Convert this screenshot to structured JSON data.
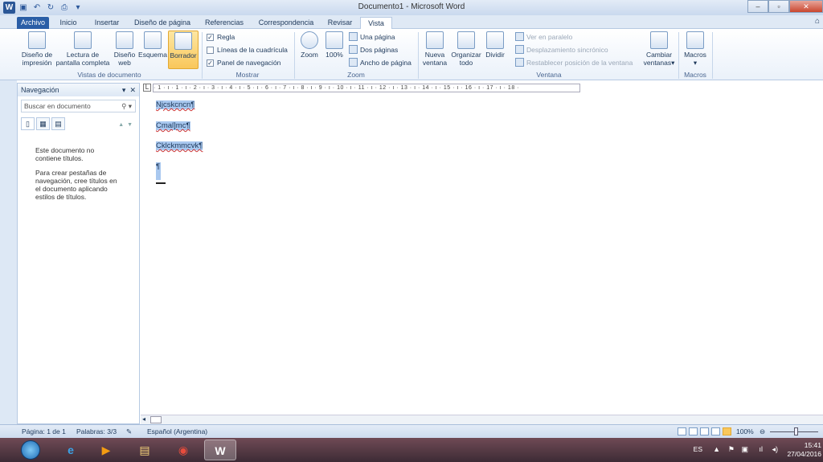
{
  "window": {
    "title": "Documento1 - Microsoft Word",
    "minimize": "–",
    "maximize": "▫",
    "close": "✕"
  },
  "qat": {
    "logo": "W",
    "save_icon": "save-icon",
    "undo": "↶",
    "redo": "↻"
  },
  "tabs": [
    "Archivo",
    "Inicio",
    "Insertar",
    "Diseño de página",
    "Referencias",
    "Correspondencia",
    "Revisar",
    "Vista"
  ],
  "active_tab": "Vista",
  "ribbon": {
    "vistas": {
      "label": "Vistas de documento",
      "buttons": [
        [
          "Diseño de",
          "impresión"
        ],
        [
          "Lectura de",
          "pantalla completa"
        ],
        [
          "Diseño",
          "web"
        ],
        [
          "Esquema",
          ""
        ],
        [
          "Borrador",
          ""
        ]
      ]
    },
    "mostrar": {
      "label": "Mostrar",
      "items": [
        {
          "text": "Regla",
          "checked": true
        },
        {
          "text": "Líneas de la cuadrícula",
          "checked": false
        },
        {
          "text": "Panel de navegación",
          "checked": true
        }
      ]
    },
    "zoom": {
      "label": "Zoom",
      "zoom_btn": "Zoom",
      "hundred": "100%",
      "items": [
        "Una página",
        "Dos páginas",
        "Ancho de página"
      ]
    },
    "ventana": {
      "label": "Ventana",
      "buttons": [
        [
          "Nueva",
          "ventana"
        ],
        [
          "Organizar",
          "todo"
        ],
        [
          "Dividir",
          ""
        ]
      ],
      "items": [
        "Ver en paralelo",
        "Desplazamiento sincrónico",
        "Restablecer posición de la ventana"
      ],
      "cambiar": [
        "Cambiar",
        "ventanas"
      ]
    },
    "macros": {
      "label": "Macros",
      "button": "Macros"
    }
  },
  "nav": {
    "title": "Navegación",
    "search_placeholder": "Buscar en documento",
    "msg1": "Este documento no contiene títulos.",
    "msg2": "Para crear pestañas de navegación, cree títulos en el documento aplicando estilos de títulos."
  },
  "ruler_text": "· 1 · ı · 1 · ı · 2 · ı · 3 · ı · 4 · ı · 5 · ı · 6 · ı · 7 · ı · 8 · ı · 9 · ı · 10 · ı · 11 · ı · 12 · ı · 13 · ı · 14 · ı · 15 · ı · 16 · ı · 17 · ı · 18 ·",
  "document": {
    "lines": [
      "Njcskcncn¶",
      "Cmal]mc¶",
      "Cklckmmcvk¶"
    ],
    "empty_para": "¶"
  },
  "status": {
    "page": "Página: 1 de 1",
    "words": "Palabras: 3/3",
    "language": "Español (Argentina)",
    "zoom": "100%"
  },
  "taskbar": {
    "lang": "ES",
    "time": "15:41",
    "date": "27/04/2016"
  }
}
